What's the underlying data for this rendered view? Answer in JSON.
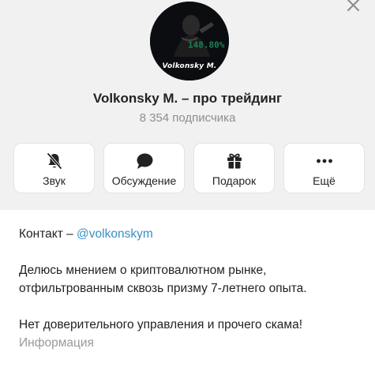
{
  "window": {
    "close_icon": "close-icon"
  },
  "channel": {
    "avatar_brand": "Volkonsky M.",
    "avatar_figure": "148.80%",
    "name": "Volkonsky M. – про трейдинг",
    "subscribers": "8 354 подписчика"
  },
  "actions": [
    {
      "label": "Звук",
      "icon": "bell-off-icon"
    },
    {
      "label": "Обсуждение",
      "icon": "chat-bubble-icon"
    },
    {
      "label": "Подарок",
      "icon": "gift-icon"
    },
    {
      "label": "Ещё",
      "icon": "more-dots-icon"
    }
  ],
  "info": {
    "contact_prefix": "Контакт – ",
    "contact_handle": "@volkonskym",
    "description_line1": "Делюсь мнением о криптовалютном рынке,",
    "description_line2": "отфильтрованным сквозь призму 7-летнего опыта.",
    "disclaimer": "Нет доверительного управления и прочего скама!",
    "caption": "Информация"
  }
}
